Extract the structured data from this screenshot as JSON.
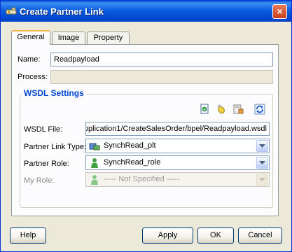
{
  "window": {
    "title": "Create Partner Link",
    "close_label": "×"
  },
  "tabs": [
    {
      "label": "General",
      "active": true
    },
    {
      "label": "Image",
      "active": false
    },
    {
      "label": "Property",
      "active": false
    }
  ],
  "general": {
    "name_label": "Name:",
    "name_value": "Readpayload",
    "process_label": "Process:",
    "process_value": ""
  },
  "wsdl": {
    "group_title": "WSDL Settings",
    "toolbar_icons": [
      "wsdl-browse-icon",
      "service-explorer-icon",
      "adapter-wizard-icon",
      "refresh-icon"
    ],
    "wsdl_file_label": "WSDL File:",
    "wsdl_file_value": "pplication1/CreateSalesOrder/bpel/Readpayload.wsdl",
    "partner_link_type_label": "Partner Link Type:",
    "partner_link_type_value": "SynchRead_plt",
    "partner_role_label": "Partner Role:",
    "partner_role_value": "SynchRead_role",
    "my_role_label": "My Role:",
    "my_role_value": "----- Not Specified -----"
  },
  "buttons": {
    "help": "Help",
    "apply": "Apply",
    "ok": "OK",
    "cancel": "Cancel"
  },
  "colors": {
    "title_bar": "#0a5fe0",
    "group_title": "#0046d5",
    "active_tab_accent": "#f7b64c"
  }
}
